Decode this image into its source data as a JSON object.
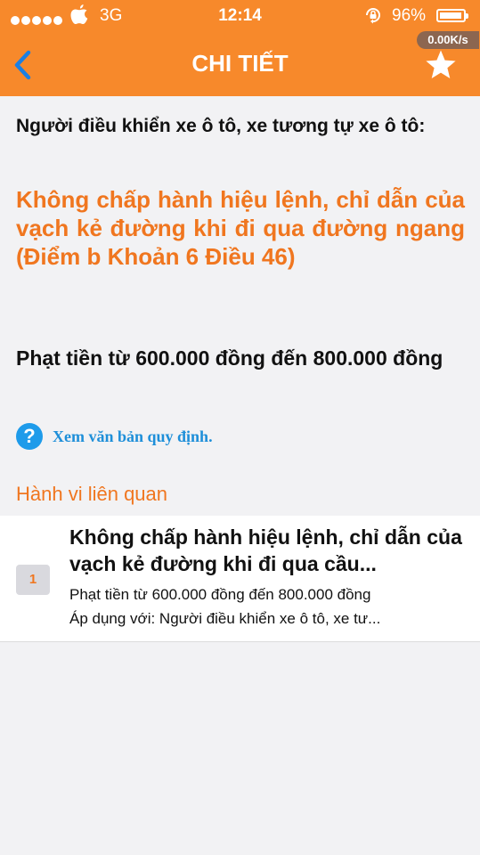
{
  "status_bar": {
    "carrier_dots": 5,
    "network": "3G",
    "time": "12:14",
    "battery_percent": "96%",
    "battery_level": 0.96
  },
  "header": {
    "title": "CHI TIẾT",
    "network_speed": "0.00K/s",
    "back_icon": "chevron-left-icon",
    "favorite_icon": "star-icon",
    "background_color": "#f7892b"
  },
  "detail": {
    "subject": "Người điều khiển xe ô tô, xe tương tự xe ô tô:",
    "violation": "Không chấp hành hiệu lệnh, chỉ dẫn của vạch kẻ đường khi đi qua đường ngang (Điểm b Khoản 6 Điều 46)",
    "fine": "Phạt tiền từ 600.000 đồng đến 800.000 đồng",
    "regulation_link": "Xem văn bản quy định.",
    "accent_color": "#f0761f",
    "link_color": "#1e8fd9"
  },
  "related": {
    "heading": "Hành vi liên quan",
    "items": [
      {
        "number": "1",
        "title": "Không chấp hành hiệu lệnh, chỉ dẫn của vạch kẻ đường khi đi qua cầu...",
        "fine": "Phạt tiền từ 600.000 đồng đến 800.000 đồng",
        "applies_to": "Áp dụng với: Người điều khiển xe ô tô, xe tư..."
      }
    ]
  }
}
